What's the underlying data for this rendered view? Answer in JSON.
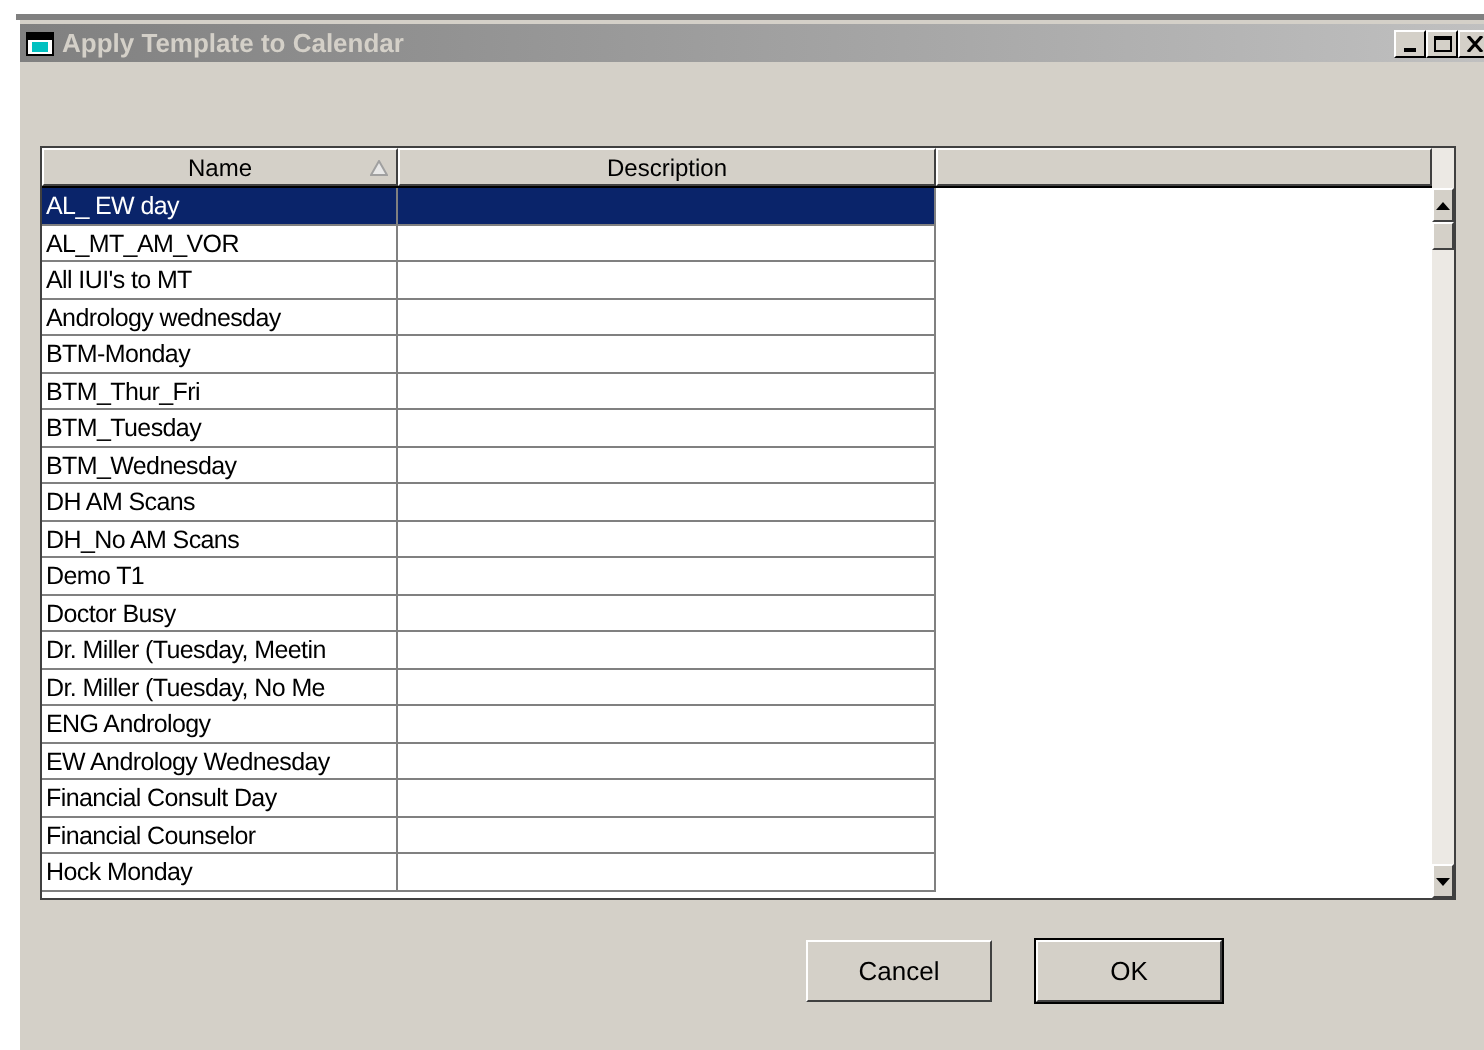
{
  "window": {
    "title": "Apply Template to Calendar",
    "active": false
  },
  "table": {
    "columns": [
      {
        "label": "Name",
        "sorted": true
      },
      {
        "label": "Description",
        "sorted": false
      }
    ],
    "rows": [
      {
        "name": "AL_ EW day",
        "selected": true
      },
      {
        "name": "AL_MT_AM_VOR",
        "selected": false
      },
      {
        "name": "All IUI's to MT",
        "selected": false
      },
      {
        "name": "Andrology wednesday",
        "selected": false
      },
      {
        "name": "BTM-Monday",
        "selected": false
      },
      {
        "name": "BTM_Thur_Fri",
        "selected": false
      },
      {
        "name": "BTM_Tuesday",
        "selected": false
      },
      {
        "name": "BTM_Wednesday",
        "selected": false
      },
      {
        "name": "DH AM Scans",
        "selected": false
      },
      {
        "name": "DH_No AM Scans",
        "selected": false
      },
      {
        "name": "Demo T1",
        "selected": false
      },
      {
        "name": "Doctor Busy",
        "selected": false
      },
      {
        "name": "Dr. Miller (Tuesday, Meetin",
        "selected": false
      },
      {
        "name": "Dr. Miller (Tuesday, No Me",
        "selected": false
      },
      {
        "name": "ENG Andrology",
        "selected": false
      },
      {
        "name": "EW Andrology Wednesday",
        "selected": false
      },
      {
        "name": "Financial Consult Day",
        "selected": false
      },
      {
        "name": "Financial Counselor",
        "selected": false
      },
      {
        "name": "Hock Monday",
        "selected": false
      }
    ]
  },
  "buttons": [
    {
      "label": "Cancel",
      "default": false
    },
    {
      "label": "OK",
      "default": true
    }
  ]
}
